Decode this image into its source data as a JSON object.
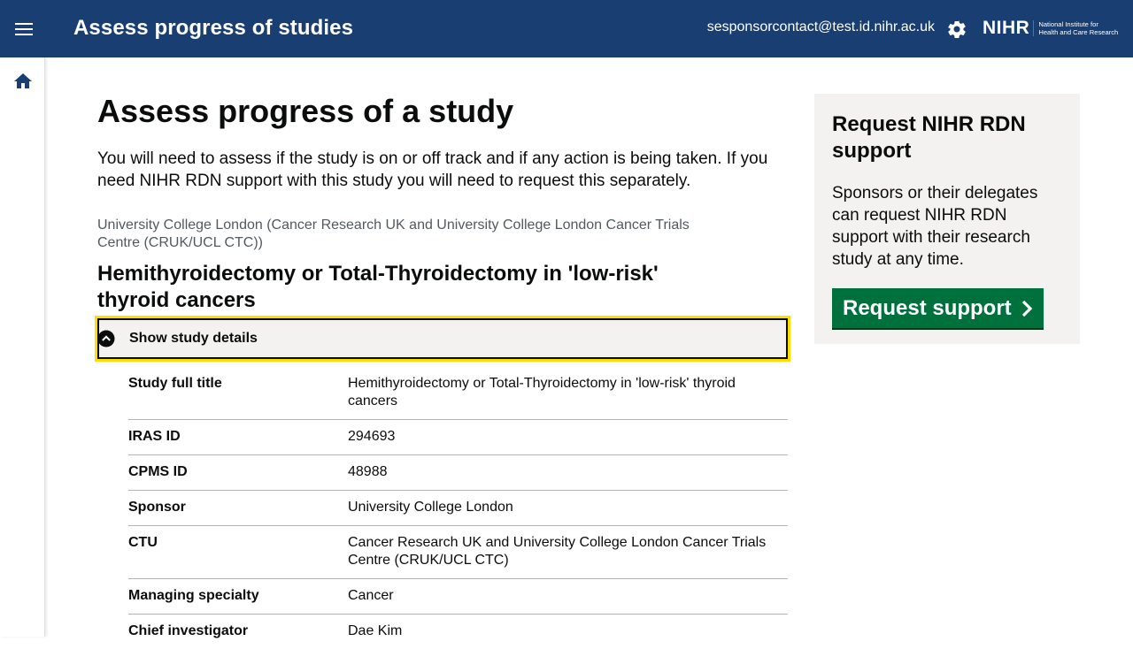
{
  "header": {
    "app_title": "Assess progress of studies",
    "user_email": "sesponsorcontact@test.id.nihr.ac.uk",
    "logo": {
      "mark": "NIHR",
      "line1": "National Institute for",
      "line2": "Health and Care Research"
    },
    "icons": {
      "menu": "menu-icon",
      "settings": "gear-icon"
    },
    "colors": {
      "background": "#193e72",
      "text": "#ffffff"
    }
  },
  "sidebar": {
    "items": [
      {
        "icon": "home-icon"
      }
    ]
  },
  "main": {
    "title": "Assess progress of a study",
    "intro": "You will need to assess if the study is on or off track and if any action is being taken. If you need NIHR RDN support with this study you will need to request this separately.",
    "organisation": "University College London (Cancer Research UK and University College London Cancer Trials Centre (CRUK/UCL CTC))",
    "study_title": "Hemithyroidectomy or Total-Thyroidectomy in 'low-risk' thyroid cancers",
    "details_toggle": {
      "label": "Show study details",
      "icon": "chevron-up-circle-icon"
    },
    "details": [
      {
        "key": "Study full title",
        "value": "Hemithyroidectomy or Total-Thyroidectomy in 'low-risk' thyroid cancers"
      },
      {
        "key": "IRAS ID",
        "value": "294693"
      },
      {
        "key": "CPMS ID",
        "value": "48988"
      },
      {
        "key": "Sponsor",
        "value": "University College London"
      },
      {
        "key": "CTU",
        "value": "Cancer Research UK and University College London Cancer Trials Centre (CRUK/UCL CTC)"
      },
      {
        "key": "Managing specialty",
        "value": "Cancer"
      },
      {
        "key": "Chief investigator",
        "value": "Dae Kim"
      }
    ]
  },
  "side_panel": {
    "title": "Request NIHR RDN support",
    "body": "Sponsors or their delegates can request NIHR RDN support with their research study at any time.",
    "button_label": "Request support",
    "button_icon": "chevron-right-icon",
    "colors": {
      "button": "#00703c",
      "panel": "#f3f2f1",
      "focus": "#ffdd00"
    }
  }
}
